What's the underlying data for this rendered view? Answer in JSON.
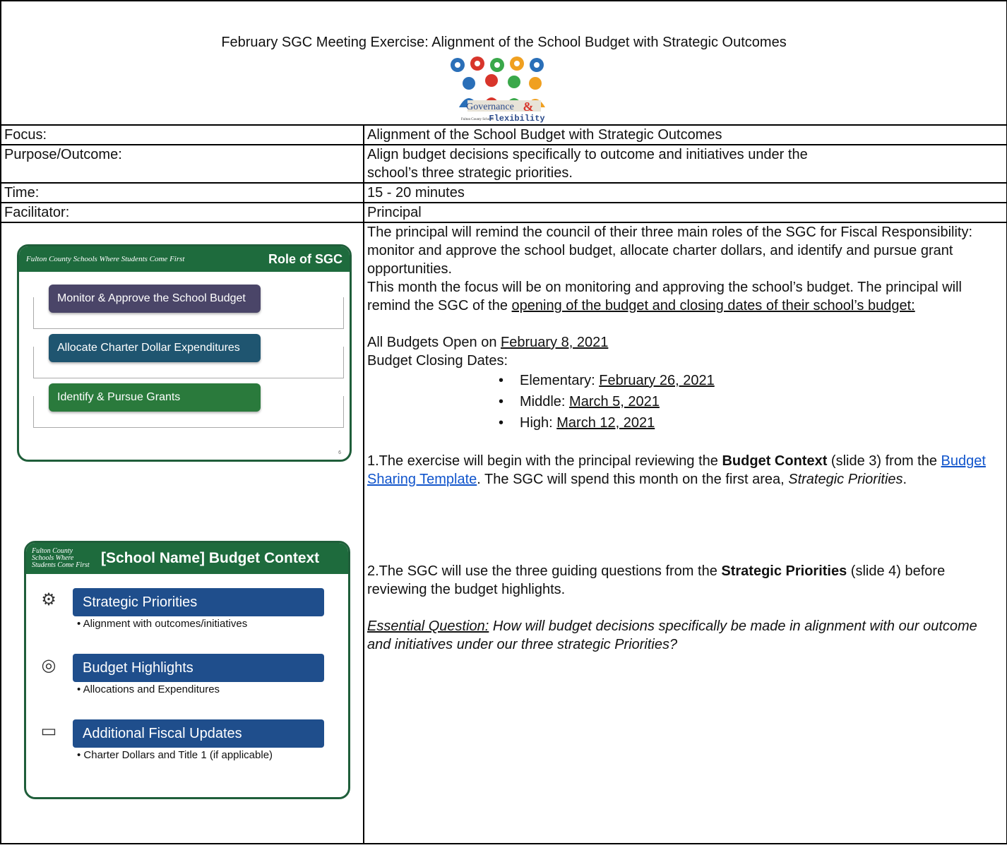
{
  "header": {
    "title": "February SGC Meeting Exercise: Alignment of the School Budget with Strategic Outcomes",
    "logo_text_top": "Governance",
    "logo_amp": "&",
    "logo_small": "Fulton County Schools",
    "logo_text_bottom": "Flexibility"
  },
  "rows": [
    {
      "label": "Focus:",
      "value": "Alignment of the School Budget with Strategic Outcomes"
    },
    {
      "label": "Purpose/Outcome:",
      "value": "Align budget decisions specifically to outcome and initiatives under the school’s three strategic priorities."
    },
    {
      "label": "Time:",
      "value": "15 - 20 minutes"
    },
    {
      "label": "Facilitator:",
      "value": "Principal"
    }
  ],
  "slide1": {
    "brand": "Fulton County Schools Where Students Come First",
    "title": "Role of SGC",
    "items": [
      "Monitor & Approve the School Budget",
      "Allocate Charter Dollar Expenditures",
      "Identify & Pursue Grants"
    ],
    "page": "6"
  },
  "slide2": {
    "brand": "Fulton County Schools Where Students Come First",
    "title": "[School Name] Budget Context",
    "items": [
      {
        "label": "Strategic Priorities",
        "sub": "• Alignment with outcomes/initiatives",
        "icon": "gears-icon"
      },
      {
        "label": "Budget Highlights",
        "sub": "• Allocations and Expenditures",
        "icon": "coins-icon"
      },
      {
        "label": "Additional Fiscal Updates",
        "sub": "• Charter Dollars and Title 1 (if applicable)",
        "icon": "money-icon"
      }
    ]
  },
  "body": {
    "p1": "The principal will remind the council of their three main roles of the SGC for Fiscal Responsibility: monitor and approve the school budget, allocate charter dollars, and identify and pursue grant opportunities.",
    "p2a": "This month the focus will be on monitoring and approving the school’s budget. The principal will remind the SGC of the ",
    "p2u": "opening of the budget and closing dates of their school’s budget:",
    "open_prefix": "All Budgets Open on ",
    "open_date": "February 8, 2021",
    "closing_label": "Budget Closing Dates:",
    "dates": [
      {
        "level": "Elementary: ",
        "date": "February 26, 2021"
      },
      {
        "level": "Middle: ",
        "date": "March 5, 2021"
      },
      {
        "level": "High: ",
        "date": "March 12, 2021"
      }
    ],
    "s1_a": "1.The exercise will begin with the principal reviewing the ",
    "s1_bold": "Budget Context",
    "s1_b": " (slide 3) from the ",
    "s1_link": "Budget Sharing Template",
    "s1_c": ". The SGC will spend this month on the first area, ",
    "s1_italic": "Strategic Priorities",
    "s1_d": ".",
    "s2_a": "2.The SGC will use the three guiding questions from the ",
    "s2_bold": "Strategic Priorities",
    "s2_b": " (slide 4) before reviewing the budget highlights.",
    "eq_label": "Essential Question:",
    "eq_text": " How will budget decisions specifically be made in alignment with our outcome and initiatives under our three strategic Priorities?"
  }
}
